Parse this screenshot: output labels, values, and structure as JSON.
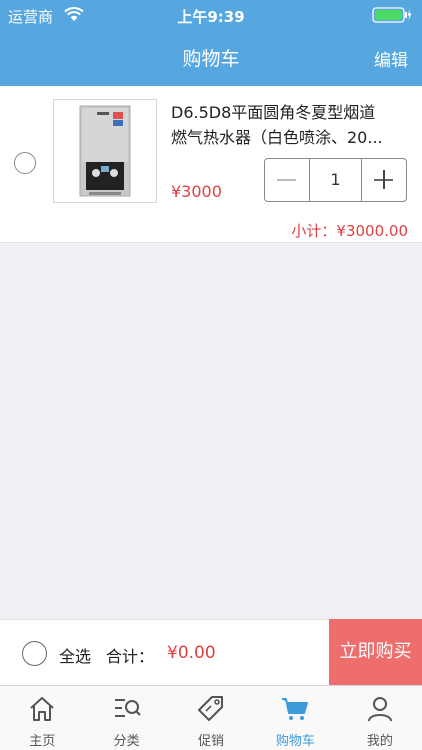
{
  "status_bar": {
    "carrier": "运营商",
    "time": "上午9:39"
  },
  "nav": {
    "title": "购物车",
    "edit_label": "编辑"
  },
  "cart_items": [
    {
      "name_line1": "D6.5D8平面圆角冬夏型烟道",
      "name_line2": "燃气热水器（白色喷涂、20...",
      "price": "¥3000",
      "quantity": "1",
      "subtotal": "小计：¥3000.00"
    }
  ],
  "checkout": {
    "select_all_label": "全选",
    "total_label": "合计：",
    "total_value": "¥0.00",
    "buy_label": "立即购买"
  },
  "tabs": [
    {
      "label": "主页",
      "icon": "home-icon"
    },
    {
      "label": "分类",
      "icon": "category-search-icon"
    },
    {
      "label": "促销",
      "icon": "tag-icon"
    },
    {
      "label": "购物车",
      "icon": "cart-icon",
      "active": true
    },
    {
      "label": "我的",
      "icon": "user-icon"
    }
  ],
  "colors": {
    "header": "#56a6df",
    "accent_red": "#e14040",
    "buy_button": "#ee6d6d",
    "active_tab": "#3d9bdc"
  }
}
